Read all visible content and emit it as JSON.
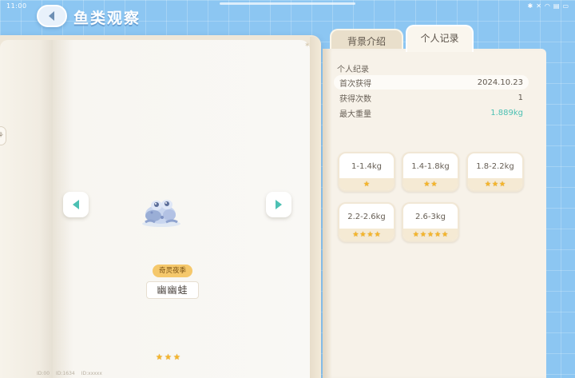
{
  "status_bar": {
    "time": "11:00",
    "icons": [
      "bluetooth-icon",
      "mute-icon",
      "wifi-icon",
      "signal-icon",
      "battery-icon"
    ]
  },
  "header": {
    "title": "鱼类观察",
    "back_icon": "arrow-left-icon"
  },
  "book": {
    "species_tag": "奇灵夜季",
    "species_name": "幽幽蛙",
    "rarity_stars": 3,
    "footer": [
      "ID:00",
      "ID:1634",
      "ID:xxxxx"
    ]
  },
  "tabs": [
    {
      "label": "背景介绍",
      "active": false
    },
    {
      "label": "个人记录",
      "active": true
    }
  ],
  "records": {
    "section_title": "个人纪录",
    "rows": [
      {
        "label": "首次获得",
        "value": "2024.10.23"
      },
      {
        "label": "获得次数",
        "value": "1"
      },
      {
        "label": "最大重量",
        "value": "1.889kg"
      }
    ]
  },
  "weight_tiers": [
    {
      "range": "1-1.4kg",
      "stars": 1
    },
    {
      "range": "1.4-1.8kg",
      "stars": 2
    },
    {
      "range": "1.8-2.2kg",
      "stars": 3
    },
    {
      "range": "2.2-2.6kg",
      "stars": 4
    },
    {
      "range": "2.6-3kg",
      "stars": 5
    }
  ],
  "colors": {
    "background": "#8cc6f2",
    "accent_teal": "#4cc0b3",
    "star": "#f5b52a",
    "tag": "#f5c86b"
  }
}
